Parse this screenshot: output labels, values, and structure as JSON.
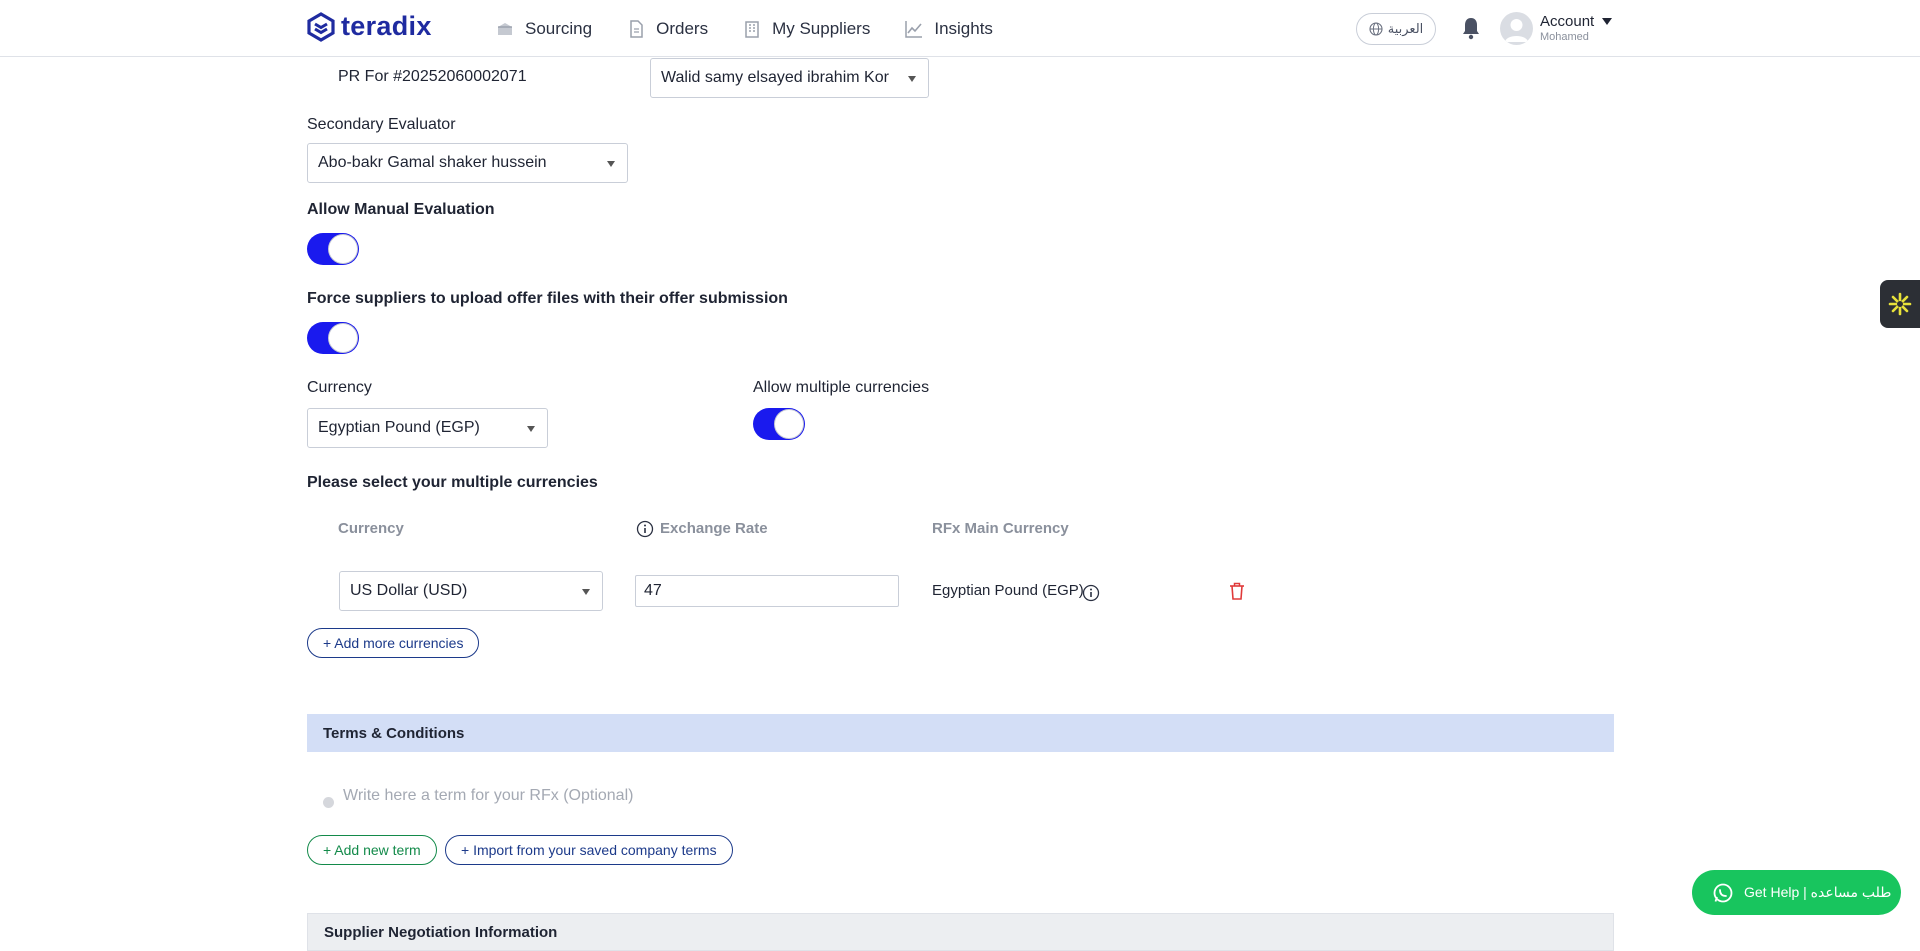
{
  "header": {
    "brand": "teradix",
    "nav": [
      {
        "label": "Sourcing",
        "icon": "box-icon"
      },
      {
        "label": "Orders",
        "icon": "document-icon"
      },
      {
        "label": "My Suppliers",
        "icon": "building-icon"
      },
      {
        "label": "Insights",
        "icon": "chart-icon"
      }
    ],
    "language_label": "العربية",
    "account_label": "Account",
    "account_user": "Mohamed"
  },
  "form": {
    "pr_for_label": "PR For #20252060002071",
    "pr_evaluator_value": "Walid samy elsayed ibrahim Kor",
    "secondary_evaluator_label": "Secondary Evaluator",
    "secondary_evaluator_value": "Abo-bakr Gamal shaker hussein",
    "allow_manual_label": "Allow Manual Evaluation",
    "allow_manual_on": true,
    "force_upload_label": "Force suppliers to upload offer files with their offer submission",
    "force_upload_on": true,
    "currency_label": "Currency",
    "currency_value": "Egyptian Pound (EGP)",
    "allow_multi_label": "Allow multiple currencies",
    "allow_multi_on": true,
    "multi_select_label": "Please select your multiple currencies",
    "table_headers": {
      "currency": "Currency",
      "exchange_rate": "Exchange Rate",
      "main_currency": "RFx Main Currency"
    },
    "rows": [
      {
        "currency": "US Dollar (USD)",
        "rate": "47",
        "main": "Egyptian Pound (EGP)"
      }
    ],
    "add_currency_label": "+ Add more currencies"
  },
  "terms": {
    "section_title": "Terms & Conditions",
    "term_placeholder": "Write here a term for your RFx (Optional)",
    "add_term_label": "+ Add new term",
    "import_terms_label": "+ Import from your saved company terms"
  },
  "next_section_title": "Supplier Negotiation Information",
  "help_label": "Get Help | طلب مساعده",
  "colors": {
    "brand": "#1f2ba0",
    "toggle_on": "#1a1aee",
    "section_bg": "#d3def6",
    "help_green": "#18c55e",
    "delete_red": "#e03a3a"
  }
}
